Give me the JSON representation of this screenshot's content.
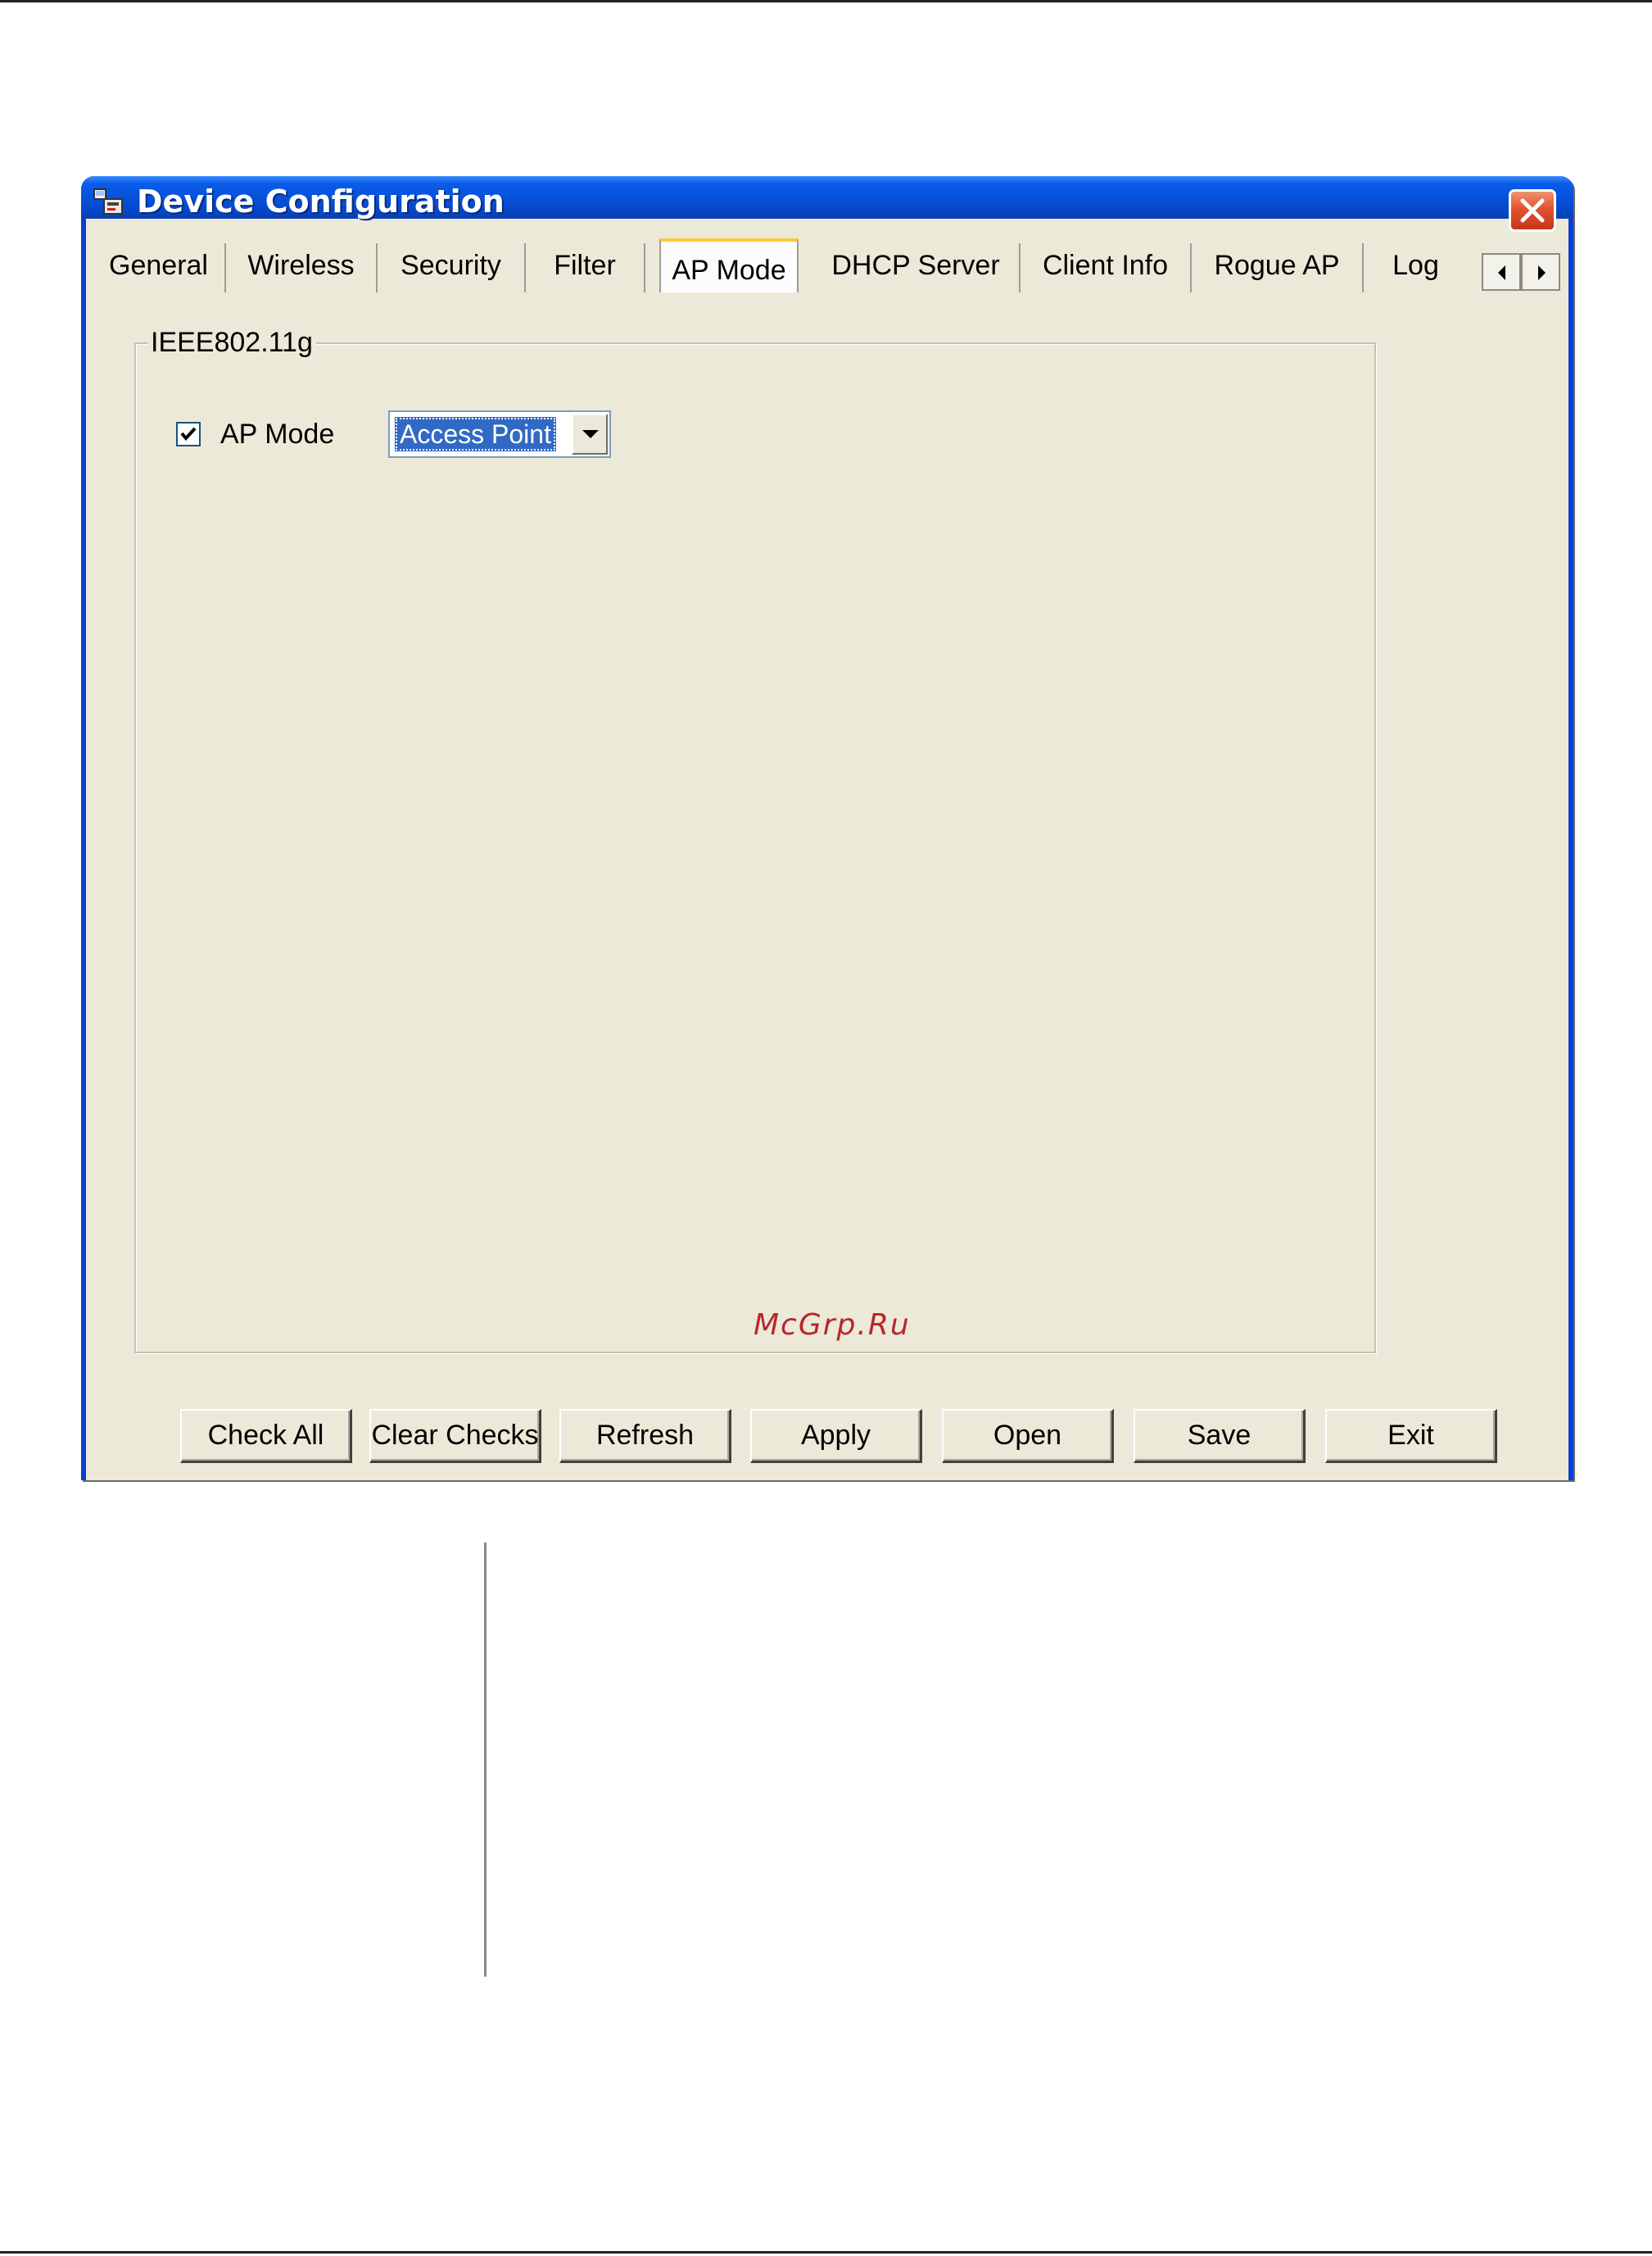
{
  "window": {
    "title": "Device Configuration",
    "title_icon": "device-config-icon",
    "close_icon": "close-icon"
  },
  "tabs": [
    {
      "label": "General",
      "selected": false
    },
    {
      "label": "Wireless",
      "selected": false
    },
    {
      "label": "Security",
      "selected": false
    },
    {
      "label": "Filter",
      "selected": false
    },
    {
      "label": "AP Mode",
      "selected": true
    },
    {
      "label": "DHCP Server",
      "selected": false
    },
    {
      "label": "Client Info",
      "selected": false
    },
    {
      "label": "Rogue AP",
      "selected": false
    },
    {
      "label": "Log",
      "selected": false
    }
  ],
  "tab_scroll": {
    "left_icon": "arrow-left-icon",
    "right_icon": "arrow-right-icon"
  },
  "panel": {
    "group_title": "IEEE802.11g",
    "ap_mode": {
      "label": "AP Mode",
      "checked": true
    },
    "mode_select": {
      "value": "Access Point"
    },
    "watermark": "McGrp.Ru"
  },
  "buttons": {
    "check_all": "Check All",
    "clear_checks": "Clear Checks",
    "refresh": "Refresh",
    "apply": "Apply",
    "open": "Open",
    "save": "Save",
    "exit": "Exit"
  },
  "colors": {
    "titlebar": "#0650d8",
    "window_face": "#ece9d8",
    "selection": "#316ac5",
    "close_button": "#e0532d",
    "selected_tab_accent": "#ffc73c",
    "watermark": "#b9262c"
  }
}
